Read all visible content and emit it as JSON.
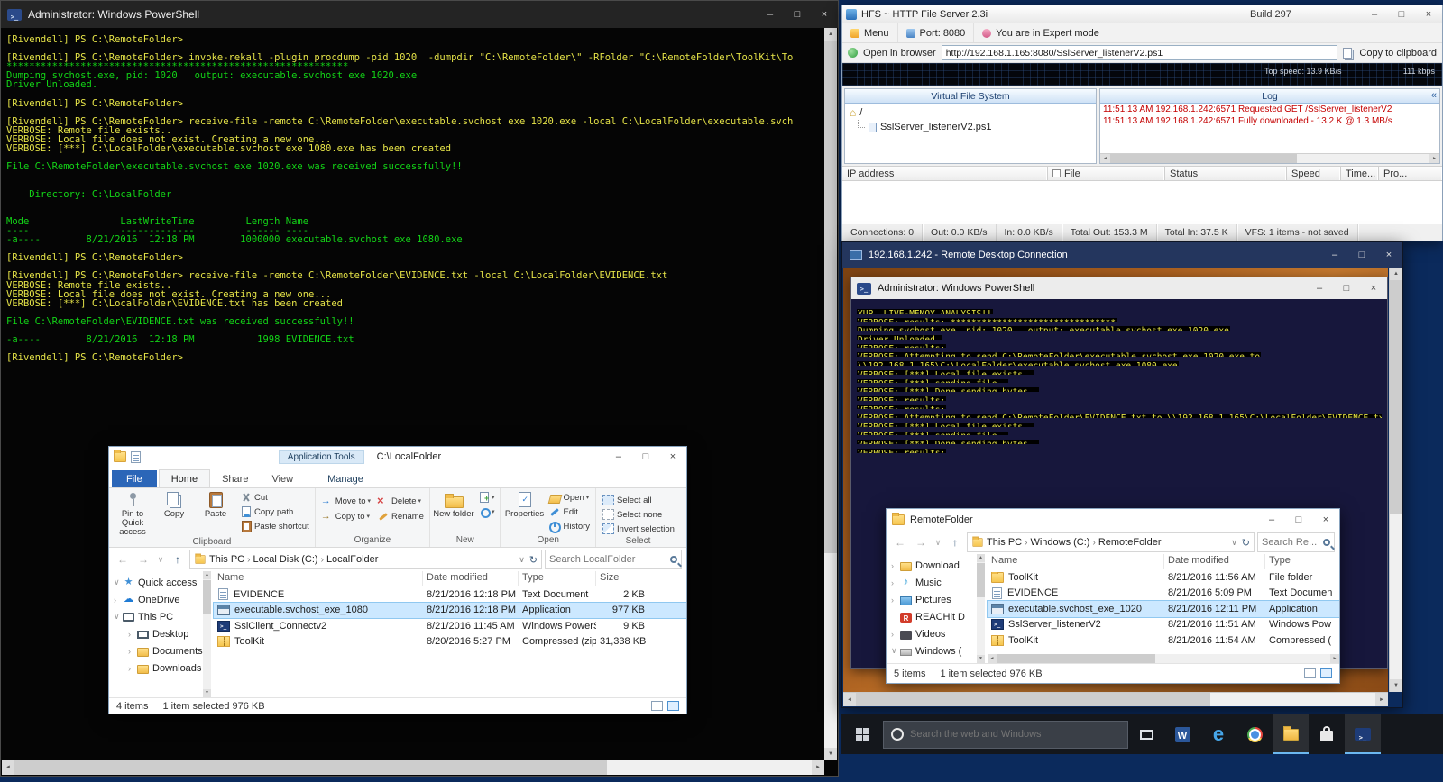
{
  "glyphs": {
    "minimize": "–",
    "maximize": "□",
    "close": "×",
    "back": "←",
    "forward": "→",
    "up": "↑",
    "refresh": "↻",
    "dropdown": "∨",
    "crumb_sep": "›",
    "collapse": "«",
    "scroll_up": "▲",
    "scroll_down": "▼",
    "scroll_left": "◄",
    "scroll_right": "►"
  },
  "left_ps": {
    "title": "Administrator: Windows PowerShell",
    "lines": [
      {
        "t": "[Rivendell] PS C:\\RemoteFolder>",
        "c": "y"
      },
      {
        "t": "",
        "c": "y"
      },
      {
        "t": "[Rivendell] PS C:\\RemoteFolder> invoke-rekall -plugin procdump -pid 1020  -dumpdir \"C:\\RemoteFolder\\\" -RFolder \"C:\\RemoteFolder\\ToolKit\\To",
        "c": "y"
      },
      {
        "t": "************************************************************",
        "c": "g"
      },
      {
        "t": "Dumping svchost.exe, pid: 1020   output: executable.svchost_exe_1020.exe",
        "c": "g"
      },
      {
        "t": "Driver Unloaded.",
        "c": "g"
      },
      {
        "t": "",
        "c": "y"
      },
      {
        "t": "[Rivendell] PS C:\\RemoteFolder>",
        "c": "y"
      },
      {
        "t": "",
        "c": "y"
      },
      {
        "t": "[Rivendell] PS C:\\RemoteFolder> receive-file -remote C:\\RemoteFolder\\executable.svchost_exe_1020.exe -local C:\\LocalFolder\\executable.svch",
        "c": "y"
      },
      {
        "t": "VERBOSE: Remote file exists..",
        "c": "y"
      },
      {
        "t": "VERBOSE: Local file does not exist. Creating a new one...",
        "c": "y"
      },
      {
        "t": "VERBOSE: [***] C:\\LocalFolder\\executable.svchost_exe_1080.exe has been created",
        "c": "y"
      },
      {
        "t": "",
        "c": "y"
      },
      {
        "t": "File C:\\RemoteFolder\\executable.svchost_exe_1020.exe was received successfully!!",
        "c": "g"
      },
      {
        "t": "",
        "c": "y"
      },
      {
        "t": "",
        "c": "y"
      },
      {
        "t": "    Directory: C:\\LocalFolder",
        "c": "g"
      },
      {
        "t": "",
        "c": "y"
      },
      {
        "t": "",
        "c": "y"
      },
      {
        "t": "Mode                LastWriteTime         Length Name",
        "c": "g"
      },
      {
        "t": "----                -------------         ------ ----",
        "c": "g"
      },
      {
        "t": "-a----        8/21/2016  12:18 PM        1000000 executable.svchost_exe_1080.exe",
        "c": "g"
      },
      {
        "t": "",
        "c": "y"
      },
      {
        "t": "[Rivendell] PS C:\\RemoteFolder>",
        "c": "y"
      },
      {
        "t": "",
        "c": "y"
      },
      {
        "t": "[Rivendell] PS C:\\RemoteFolder> receive-file -remote C:\\RemoteFolder\\EVIDENCE.txt -local C:\\LocalFolder\\EVIDENCE.txt",
        "c": "y"
      },
      {
        "t": "VERBOSE: Remote file exists..",
        "c": "y"
      },
      {
        "t": "VERBOSE: Local file does not exist. Creating a new one...",
        "c": "y"
      },
      {
        "t": "VERBOSE: [***] C:\\LocalFolder\\EVIDENCE.txt has been created",
        "c": "y"
      },
      {
        "t": "",
        "c": "y"
      },
      {
        "t": "File C:\\RemoteFolder\\EVIDENCE.txt was received successfully!!",
        "c": "g"
      },
      {
        "t": "",
        "c": "y"
      },
      {
        "t": "-a----        8/21/2016  12:18 PM           1998 EVIDENCE.txt",
        "c": "g"
      },
      {
        "t": "",
        "c": "y"
      },
      {
        "t": "[Rivendell] PS C:\\RemoteFolder>",
        "c": "y"
      }
    ]
  },
  "local_explorer": {
    "contextual_tab": "Application Tools",
    "title": "C:\\LocalFolder",
    "tabs": {
      "file": "File",
      "home": "Home",
      "share": "Share",
      "view": "View",
      "manage": "Manage"
    },
    "ribbon": {
      "pin": "Pin to Quick access",
      "copy": "Copy",
      "paste": "Paste",
      "cut": "Cut",
      "copy_path": "Copy path",
      "paste_shortcut": "Paste shortcut",
      "move_to": "Move to",
      "copy_to": "Copy to",
      "delete": "Delete",
      "rename": "Rename",
      "new_folder": "New folder",
      "properties": "Properties",
      "open": "Open",
      "edit": "Edit",
      "history": "History",
      "select_all": "Select all",
      "select_none": "Select none",
      "invert_selection": "Invert selection",
      "g_clipboard": "Clipboard",
      "g_organize": "Organize",
      "g_new": "New",
      "g_open": "Open",
      "g_select": "Select"
    },
    "breadcrumb": [
      "This PC",
      "Local Disk (C:)",
      "LocalFolder"
    ],
    "search_placeholder": "Search LocalFolder",
    "nav": [
      {
        "label": "Quick access",
        "ic": "nvi-star",
        "ch": "ch-open",
        "ind": ""
      },
      {
        "label": "OneDrive",
        "ic": "nvi-cloud",
        "ch": "ch-closed",
        "ind": ""
      },
      {
        "label": "This PC",
        "ic": "nvi-pc",
        "ch": "ch-open",
        "ind": ""
      },
      {
        "label": "Desktop",
        "ic": "nvi-desk",
        "ch": "ch-closed",
        "ind": "ind"
      },
      {
        "label": "Documents",
        "ic": "nvi-docs",
        "ch": "ch-closed",
        "ind": "ind"
      },
      {
        "label": "Downloads",
        "ic": "nvi-down",
        "ch": "ch-closed",
        "ind": "ind"
      }
    ],
    "columns": [
      "Name",
      "Date modified",
      "Type",
      "Size"
    ],
    "rows": [
      {
        "name": "EVIDENCE",
        "date": "8/21/2016 12:18 PM",
        "type": "Text Document",
        "size": "2 KB",
        "icon": "fi-text",
        "sel": ""
      },
      {
        "name": "executable.svchost_exe_1080",
        "date": "8/21/2016 12:18 PM",
        "type": "Application",
        "size": "977 KB",
        "icon": "fi-app",
        "sel": "selected"
      },
      {
        "name": "SslClient_Connectv2",
        "date": "8/21/2016 11:45 AM",
        "type": "Windows PowerS...",
        "size": "9 KB",
        "icon": "fi-ps",
        "sel": ""
      },
      {
        "name": "ToolKit",
        "date": "8/20/2016 5:27 PM",
        "type": "Compressed (zipp...",
        "size": "31,338 KB",
        "icon": "fi-zip",
        "sel": ""
      }
    ],
    "status_items": "4 items",
    "status_selected": "1 item selected 976 KB"
  },
  "hfs": {
    "title": "HFS ~ HTTP File Server 2.3i",
    "build": "Build 297",
    "menu": "Menu",
    "port": "Port: 8080",
    "mode": "You are in Expert mode",
    "open_in_browser": "Open in browser",
    "url": "http://192.168.1.165:8080/SslServer_listenerV2.ps1",
    "copy_to_clipboard": "Copy to clipboard",
    "top_speed": "Top speed: 13.9 KB/s",
    "kbps": "111 kbps",
    "vfs_title": "Virtual File System",
    "log_title": "Log",
    "tree_root": "/",
    "tree_child": "SslServer_listenerV2.ps1",
    "log_lines": [
      "11:51:13 AM 192.168.1.242:6571 Requested GET /SslServer_listenerV2",
      "11:51:13 AM 192.168.1.242:6571 Fully downloaded - 13.2 K @ 1.3 MB/s"
    ],
    "table_columns": [
      "IP address",
      "File",
      "Status",
      "Speed",
      "Time...",
      "Pro..."
    ],
    "status": [
      "Connections: 0",
      "Out: 0.0 KB/s",
      "In: 0.0 KB/s",
      "Total Out: 153.3 M",
      "Total In: 37.5 K",
      "VFS: 1 items - not saved"
    ]
  },
  "rdp": {
    "title": "192.168.1.242 - Remote Desktop Connection",
    "ps": {
      "title": "Administrator: Windows PowerShell",
      "lines": [
        "YUP, LIVE-MEMOY ANALYSIS!!",
        "VERBOSE: results: ********************************",
        "Dumping svchost.exe, pid: 1020   output: executable.svchost_exe_1020.exe",
        "Driver Unloaded.",
        "VERBOSE: results:",
        "VERBOSE: Attempting to send C:\\RemoteFolder\\executable.svchost_exe_1020.exe to",
        "\\\\192.168.1.165\\C:\\LocalFolder\\executable.svchost_exe_1080.exe",
        "VERBOSE: [***] Local file exists..",
        "VERBOSE: [***] sending file..",
        "VERBOSE: [***] Done sending bytes..",
        "VERBOSE: results:",
        "VERBOSE: results:",
        "VERBOSE: Attempting to send C:\\RemoteFolder\\EVIDENCE.txt to \\\\192.168.1.165\\C:\\LocalFolder\\EVIDENCE.tx",
        "VERBOSE: [***] Local file exists..",
        "VERBOSE: [***] sending file..",
        "VERBOSE: [***] Done sending bytes..",
        "VERBOSE: results:"
      ]
    },
    "explorer": {
      "title": "RemoteFolder",
      "breadcrumb": [
        "This PC",
        "Windows (C:)",
        "RemoteFolder"
      ],
      "search_placeholder": "Search Re...",
      "nav": [
        {
          "label": "Download",
          "ic": "nvi-down",
          "ch": "ch-closed",
          "ind": ""
        },
        {
          "label": "Music",
          "ic": "nvi-music",
          "ch": "ch-closed",
          "ind": ""
        },
        {
          "label": "Pictures",
          "ic": "nvi-pic",
          "ch": "ch-closed",
          "ind": ""
        },
        {
          "label": "REACHit D",
          "ic": "nvi-reach",
          "ch": "",
          "ind": ""
        },
        {
          "label": "Videos",
          "ic": "nvi-video",
          "ch": "ch-closed",
          "ind": ""
        },
        {
          "label": "Windows (",
          "ic": "nvi-disk",
          "ch": "ch-open",
          "ind": ""
        }
      ],
      "columns": [
        "Name",
        "Date modified",
        "Type"
      ],
      "rows": [
        {
          "name": "ToolKit",
          "date": "8/21/2016 11:56 AM",
          "type": "File folder",
          "icon": "fi-folder",
          "sel": ""
        },
        {
          "name": "EVIDENCE",
          "date": "8/21/2016 5:09 PM",
          "type": "Text Documen",
          "icon": "fi-text",
          "sel": ""
        },
        {
          "name": "executable.svchost_exe_1020",
          "date": "8/21/2016 12:11 PM",
          "type": "Application",
          "icon": "fi-app",
          "sel": "selected"
        },
        {
          "name": "SslServer_listenerV2",
          "date": "8/21/2016 11:51 AM",
          "type": "Windows Pow",
          "icon": "fi-ps",
          "sel": ""
        },
        {
          "name": "ToolKit",
          "date": "8/21/2016 11:54 AM",
          "type": "Compressed (",
          "icon": "fi-zip",
          "sel": ""
        }
      ],
      "status_items": "5 items",
      "status_selected": "1 item selected  976 KB"
    }
  },
  "taskbar": {
    "search_placeholder": "Search the web and Windows"
  }
}
